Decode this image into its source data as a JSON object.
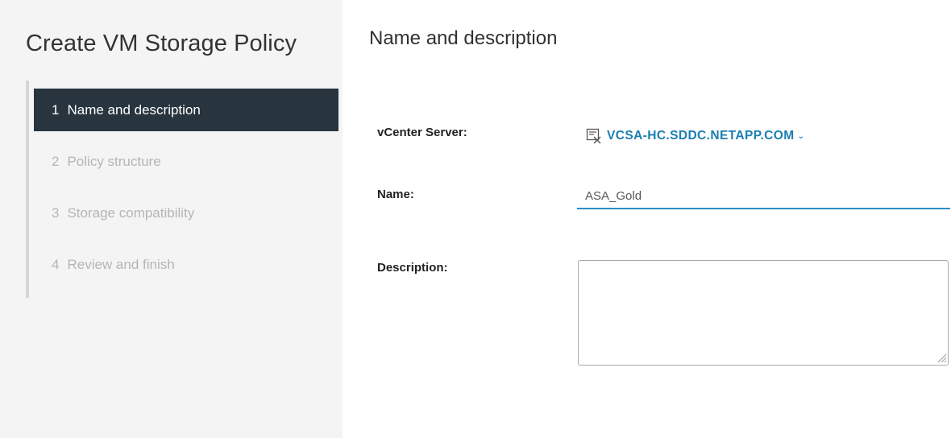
{
  "wizard": {
    "title": "Create VM Storage Policy",
    "steps": [
      {
        "num": "1",
        "label": "Name and description",
        "active": true
      },
      {
        "num": "2",
        "label": "Policy structure",
        "active": false
      },
      {
        "num": "3",
        "label": "Storage compatibility",
        "active": false
      },
      {
        "num": "4",
        "label": "Review and finish",
        "active": false
      }
    ]
  },
  "content": {
    "title": "Name and description",
    "vcenter": {
      "label": "vCenter Server:",
      "value": "VCSA-HC.SDDC.NETAPP.COM",
      "icon": "vcenter-server-icon",
      "chevron": "chevron-down-icon"
    },
    "name": {
      "label": "Name:",
      "value": "ASA_Gold"
    },
    "description": {
      "label": "Description:",
      "value": ""
    }
  },
  "colors": {
    "active_step_bg": "#28353f",
    "link": "#1a7fb0",
    "input_underline": "#2d8fc6",
    "panel_bg": "#f4f4f4"
  }
}
